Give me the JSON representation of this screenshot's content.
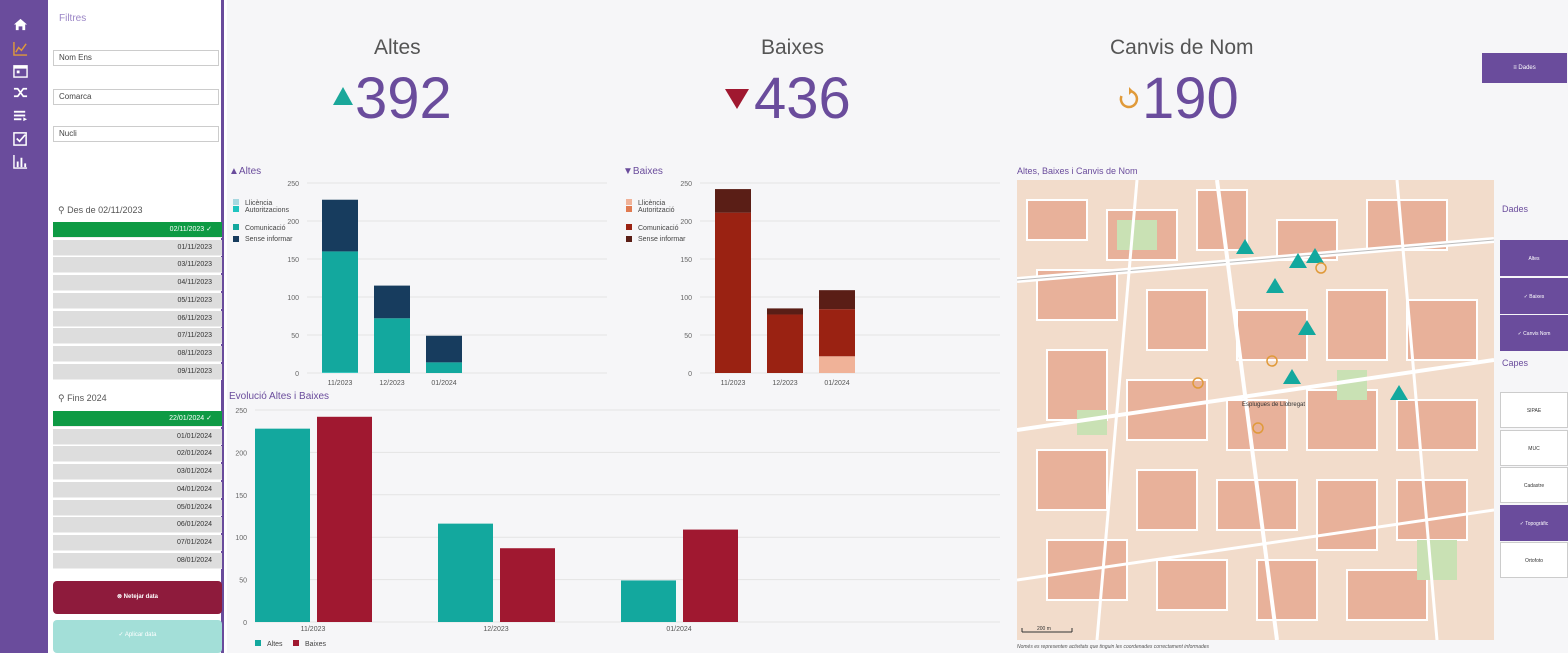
{
  "nav": {
    "icons": [
      "home-icon",
      "chart-icon",
      "calendar-icon",
      "shuffle-icon",
      "list-icon",
      "checkbox-icon",
      "bar-chart-icon"
    ]
  },
  "filters": {
    "title": "Filtres",
    "nom_ens": "Nom Ens",
    "comarca": "Comarca",
    "nucli": "Nucli",
    "from_label": "Des de 02/11/2023",
    "from_dates": [
      "02/11/2023 ✓",
      "01/11/2023",
      "03/11/2023",
      "04/11/2023",
      "05/11/2023",
      "06/11/2023",
      "07/11/2023",
      "08/11/2023",
      "09/11/2023"
    ],
    "to_label": "Fins 2024",
    "to_dates": [
      "22/01/2024 ✓",
      "01/01/2024",
      "02/01/2024",
      "03/01/2024",
      "04/01/2024",
      "05/01/2024",
      "06/01/2024",
      "07/01/2024",
      "08/01/2024"
    ],
    "reset_label": "⊗ Netejar data",
    "apply_label": "✓ Aplicar data"
  },
  "kpis": {
    "altes": {
      "label": "Altes",
      "value": "392",
      "color": "#1aa79a"
    },
    "baixes": {
      "label": "Baixes",
      "value": "436",
      "color": "#a01830"
    },
    "canvis": {
      "label": "Canvis de Nom",
      "value": "190",
      "color": "#e09a3a"
    }
  },
  "dades_button": "≡ Dades",
  "chart_data": [
    {
      "type": "bar",
      "title": "▲Altes",
      "categories": [
        "11/2023",
        "12/2023",
        "01/2024"
      ],
      "series": [
        {
          "name": "Llicència",
          "color": "#a8d8e0",
          "values": [
            0,
            0,
            0
          ]
        },
        {
          "name": "Autoritzacions",
          "color": "#20c4c0",
          "values": [
            1,
            0,
            0
          ]
        },
        {
          "name": "Comunicació",
          "color": "#13a89e",
          "values": [
            159,
            72,
            14
          ]
        },
        {
          "name": "Sense informar",
          "color": "#173c5e",
          "values": [
            68,
            43,
            35
          ]
        }
      ],
      "ylim": [
        0,
        250
      ],
      "yticks": [
        0,
        50,
        100,
        150,
        200,
        250
      ],
      "stacked": true,
      "legend": "left"
    },
    {
      "type": "bar",
      "title": "▼Baixes",
      "categories": [
        "11/2023",
        "12/2023",
        "01/2024"
      ],
      "series": [
        {
          "name": "Llicència",
          "color": "#f0b298",
          "values": [
            0,
            0,
            22
          ]
        },
        {
          "name": "Autorització",
          "color": "#e07a50",
          "values": [
            0,
            0,
            0
          ]
        },
        {
          "name": "Comunicació",
          "color": "#9a2212",
          "values": [
            211,
            77,
            62
          ]
        },
        {
          "name": "Sense informar",
          "color": "#5a1e16",
          "values": [
            31,
            8,
            25
          ]
        }
      ],
      "ylim": [
        0,
        250
      ],
      "yticks": [
        0,
        50,
        100,
        150,
        200,
        250
      ],
      "stacked": true,
      "legend": "left"
    },
    {
      "type": "bar",
      "title": "Evolució Altes i Baixes",
      "categories": [
        "11/2023",
        "12/2023",
        "01/2024"
      ],
      "series": [
        {
          "name": "Altes",
          "color": "#13a89e",
          "values": [
            228,
            116,
            49
          ]
        },
        {
          "name": "Baixes",
          "color": "#a01830",
          "values": [
            242,
            87,
            109
          ]
        }
      ],
      "ylim": [
        0,
        250
      ],
      "yticks": [
        0,
        50,
        100,
        150,
        200,
        250
      ],
      "stacked": false,
      "legend": "bottom"
    }
  ],
  "map": {
    "title": "Altes, Baixes i Canvis de Nom",
    "city_label": "Esplugues de Llobregat",
    "scale_label": "200 m",
    "note": "Només es representen activitats que tinguin les coordenades correctament informades"
  },
  "side": {
    "dades_title": "Dades",
    "dades_buttons": [
      {
        "label": "Altes",
        "on": true
      },
      {
        "label": "✓ Baixes",
        "on": true
      },
      {
        "label": "✓ Canvis Nom",
        "on": true
      }
    ],
    "capes_title": "Capes",
    "capes_buttons": [
      {
        "label": "SIPAE",
        "on": false
      },
      {
        "label": "MUC",
        "on": false
      },
      {
        "label": "Cadastre",
        "on": false
      },
      {
        "label": "✓ Topogràfic",
        "on": true
      },
      {
        "label": "Ortofoto",
        "on": false
      }
    ]
  }
}
